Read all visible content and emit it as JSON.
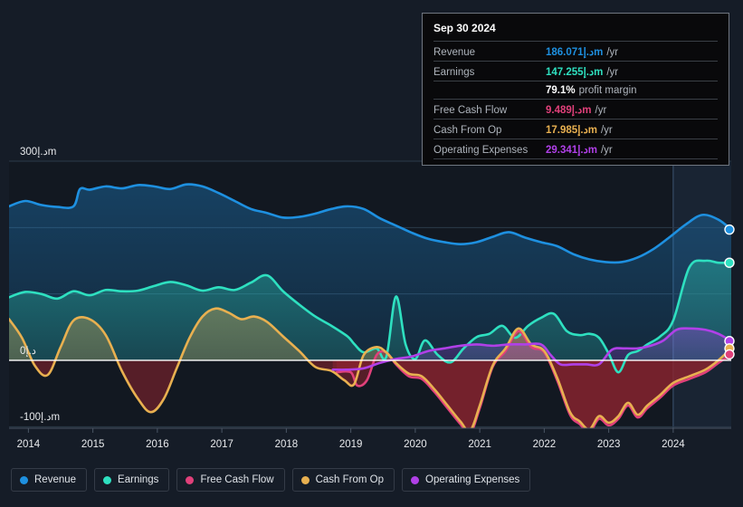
{
  "theme": {
    "page_bg": "#151c27",
    "plot_bg": "#121821",
    "grid_color": "#2c3a4a",
    "zero_line_color": "#ffffff",
    "axis_text": "#e8eaed",
    "highlight_band": "#1a2636"
  },
  "currency_suffix": "د.إm",
  "tooltip": {
    "date": "Sep 30 2024",
    "rows": [
      {
        "label": "Revenue",
        "value": "186.071د.إm",
        "unit": "/yr",
        "color": "#1e90e0"
      },
      {
        "label": "Earnings",
        "value": "147.255د.إm",
        "unit": "/yr",
        "color": "#2ee0c0"
      },
      {
        "label": "",
        "value": "79.1%",
        "unit": "profit margin",
        "color": "#ffffff"
      },
      {
        "label": "Free Cash Flow",
        "value": "9.489د.إm",
        "unit": "/yr",
        "color": "#e0407a"
      },
      {
        "label": "Cash From Op",
        "value": "17.985د.إm",
        "unit": "/yr",
        "color": "#e8b050"
      },
      {
        "label": "Operating Expenses",
        "value": "29.341د.إm",
        "unit": "/yr",
        "color": "#b040e8"
      }
    ]
  },
  "legend": {
    "items": [
      {
        "label": "Revenue",
        "color": "#1e90e0"
      },
      {
        "label": "Earnings",
        "color": "#2ee0c0"
      },
      {
        "label": "Free Cash Flow",
        "color": "#e0407a"
      },
      {
        "label": "Cash From Op",
        "color": "#e8b050"
      },
      {
        "label": "Operating Expenses",
        "color": "#b040e8"
      }
    ]
  },
  "chart_data": {
    "type": "area",
    "title": "",
    "xlabel": "",
    "ylabel": "",
    "grid": true,
    "legend_position": "bottom",
    "x_tick_labels": [
      "2014",
      "2015",
      "2016",
      "2017",
      "2018",
      "2019",
      "2020",
      "2021",
      "2022",
      "2023",
      "2024"
    ],
    "x_tick_values": [
      2014,
      2015,
      2016,
      2017,
      2018,
      2019,
      2020,
      2021,
      2022,
      2023,
      2024
    ],
    "y_tick_labels": [
      "300د.إm",
      "0د.إ",
      "-100د.إm"
    ],
    "y_tick_values": [
      300,
      0,
      -100
    ],
    "y_gridline_values": [
      300,
      200,
      100,
      0,
      -100
    ],
    "xlim": [
      2013.7,
      2024.9
    ],
    "ylim": [
      -130,
      320
    ],
    "units": "د.إ millions per year",
    "highlight_band_x": [
      2024.0,
      2024.9
    ],
    "series": [
      {
        "name": "Revenue",
        "color": "#1e90e0",
        "x": [
          2013.7,
          2013.95,
          2014.2,
          2014.45,
          2014.7,
          2014.8,
          2014.95,
          2015.2,
          2015.45,
          2015.7,
          2015.95,
          2016.2,
          2016.45,
          2016.7,
          2016.95,
          2017.2,
          2017.45,
          2017.7,
          2017.95,
          2018.2,
          2018.45,
          2018.7,
          2018.95,
          2019.2,
          2019.45,
          2019.7,
          2019.95,
          2020.2,
          2020.45,
          2020.7,
          2020.95,
          2021.2,
          2021.45,
          2021.7,
          2021.95,
          2022.2,
          2022.45,
          2022.7,
          2022.95,
          2023.2,
          2023.45,
          2023.7,
          2023.95,
          2024.2,
          2024.45,
          2024.7,
          2024.9
        ],
        "y": [
          232,
          240,
          234,
          231,
          232,
          258,
          257,
          262,
          259,
          264,
          262,
          258,
          265,
          262,
          252,
          240,
          228,
          222,
          215,
          216,
          221,
          228,
          232,
          228,
          214,
          203,
          192,
          183,
          178,
          175,
          178,
          186,
          193,
          185,
          178,
          172,
          160,
          152,
          148,
          148,
          155,
          168,
          186,
          205,
          219,
          212,
          197
        ]
      },
      {
        "name": "Earnings",
        "color": "#2ee0c0",
        "x": [
          2013.7,
          2013.95,
          2014.2,
          2014.45,
          2014.7,
          2014.95,
          2015.2,
          2015.45,
          2015.7,
          2015.95,
          2016.2,
          2016.45,
          2016.7,
          2016.95,
          2017.2,
          2017.45,
          2017.7,
          2017.95,
          2018.2,
          2018.45,
          2018.7,
          2018.95,
          2019.05,
          2019.2,
          2019.4,
          2019.55,
          2019.7,
          2019.85,
          2020.0,
          2020.15,
          2020.35,
          2020.55,
          2020.75,
          2020.95,
          2021.15,
          2021.35,
          2021.55,
          2021.75,
          2021.95,
          2022.15,
          2022.35,
          2022.55,
          2022.7,
          2022.85,
          2023.0,
          2023.15,
          2023.3,
          2023.45,
          2023.6,
          2023.8,
          2024.0,
          2024.25,
          2024.5,
          2024.7,
          2024.9
        ],
        "y": [
          95,
          103,
          100,
          93,
          104,
          98,
          106,
          104,
          105,
          112,
          118,
          113,
          105,
          110,
          106,
          117,
          128,
          104,
          84,
          66,
          52,
          36,
          25,
          12,
          18,
          5,
          96,
          24,
          2,
          30,
          8,
          -3,
          18,
          35,
          40,
          52,
          34,
          52,
          64,
          70,
          44,
          38,
          40,
          34,
          10,
          -18,
          8,
          14,
          24,
          36,
          60,
          140,
          150,
          147,
          147
        ]
      },
      {
        "name": "Free Cash Flow",
        "color": "#e0407a",
        "x": [
          2018.78,
          2019.0,
          2019.1,
          2019.25,
          2019.4,
          2019.55,
          2019.7,
          2019.9,
          2020.1,
          2020.3,
          2020.5,
          2020.7,
          2020.85,
          2021.0,
          2021.2,
          2021.4,
          2021.6,
          2021.8,
          2022.0,
          2022.2,
          2022.4,
          2022.55,
          2022.7,
          2022.85,
          2023.0,
          2023.15,
          2023.3,
          2023.45,
          2023.6,
          2023.8,
          2024.0,
          2024.25,
          2024.5,
          2024.7,
          2024.9
        ],
        "y": [
          -18,
          -18,
          -38,
          -30,
          8,
          12,
          -6,
          -24,
          -28,
          -48,
          -72,
          -96,
          -110,
          -72,
          -10,
          14,
          44,
          20,
          12,
          -30,
          -82,
          -96,
          -108,
          -88,
          -98,
          -88,
          -68,
          -86,
          -72,
          -56,
          -38,
          -28,
          -18,
          -4,
          9
        ]
      },
      {
        "name": "Cash From Op",
        "color": "#e8b050",
        "x": [
          2013.7,
          2013.9,
          2014.1,
          2014.3,
          2014.5,
          2014.7,
          2014.95,
          2015.2,
          2015.45,
          2015.7,
          2015.9,
          2016.1,
          2016.3,
          2016.5,
          2016.7,
          2016.9,
          2017.1,
          2017.3,
          2017.5,
          2017.7,
          2017.95,
          2018.2,
          2018.45,
          2018.7,
          2018.9,
          2019.05,
          2019.2,
          2019.4,
          2019.55,
          2019.7,
          2019.9,
          2020.1,
          2020.3,
          2020.5,
          2020.7,
          2020.85,
          2021.0,
          2021.2,
          2021.4,
          2021.6,
          2021.8,
          2022.0,
          2022.2,
          2022.4,
          2022.55,
          2022.7,
          2022.85,
          2023.0,
          2023.15,
          2023.3,
          2023.45,
          2023.6,
          2023.8,
          2024.0,
          2024.25,
          2024.5,
          2024.7,
          2024.9
        ],
        "y": [
          62,
          34,
          -8,
          -22,
          20,
          60,
          62,
          38,
          -16,
          -58,
          -78,
          -58,
          -12,
          34,
          66,
          78,
          72,
          62,
          66,
          58,
          36,
          14,
          -10,
          -16,
          -30,
          -36,
          8,
          20,
          12,
          -4,
          -20,
          -24,
          -44,
          -68,
          -92,
          -106,
          -68,
          -8,
          18,
          48,
          24,
          14,
          -26,
          -78,
          -92,
          -104,
          -84,
          -94,
          -84,
          -64,
          -82,
          -68,
          -52,
          -34,
          -24,
          -14,
          0,
          18
        ]
      },
      {
        "name": "Operating Expenses",
        "color": "#b040e8",
        "x": [
          2018.72,
          2018.95,
          2019.2,
          2019.45,
          2019.7,
          2019.95,
          2020.2,
          2020.45,
          2020.7,
          2020.95,
          2021.2,
          2021.45,
          2021.7,
          2021.95,
          2022.1,
          2022.25,
          2022.45,
          2022.65,
          2022.85,
          2023.05,
          2023.25,
          2023.45,
          2023.65,
          2023.85,
          2024.05,
          2024.25,
          2024.5,
          2024.7,
          2024.9
        ],
        "y": [
          -14,
          -14,
          -12,
          -4,
          2,
          6,
          14,
          18,
          22,
          24,
          22,
          24,
          24,
          24,
          8,
          -6,
          -6,
          -6,
          -6,
          16,
          18,
          18,
          22,
          30,
          46,
          48,
          46,
          40,
          29
        ]
      }
    ],
    "endpoint_markers": [
      {
        "series": "Revenue",
        "value": 197,
        "color": "#1e90e0"
      },
      {
        "series": "Earnings",
        "value": 147,
        "color": "#2ee0c0"
      },
      {
        "series": "Operating Expenses",
        "value": 29,
        "color": "#b040e8"
      },
      {
        "series": "Cash From Op",
        "value": 18,
        "color": "#e8b050"
      },
      {
        "series": "Free Cash Flow",
        "value": 9,
        "color": "#e0407a"
      }
    ]
  }
}
